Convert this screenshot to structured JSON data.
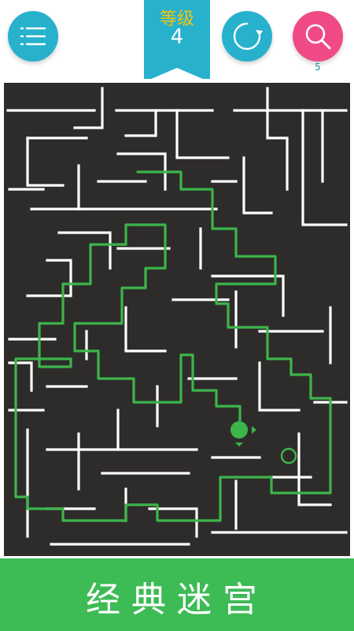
{
  "header": {
    "level_title": "等级",
    "level_number": "4",
    "hint_count": "5"
  },
  "buttons": {
    "menu_icon": "menu-list-icon",
    "restart_icon": "restart-circle-icon",
    "hint_icon": "search-magnifier-icon"
  },
  "banner": {
    "title": "经典迷宫"
  },
  "colors": {
    "maze_bg": "#2e2c2b",
    "wall": "#ffffff",
    "path": "#3cb54a",
    "player": "#3cb54a",
    "goal": "#3cb54a",
    "accent_blue": "#27b1cd",
    "accent_pink": "#ef4a86",
    "banner_green": "#3dbb55"
  }
}
